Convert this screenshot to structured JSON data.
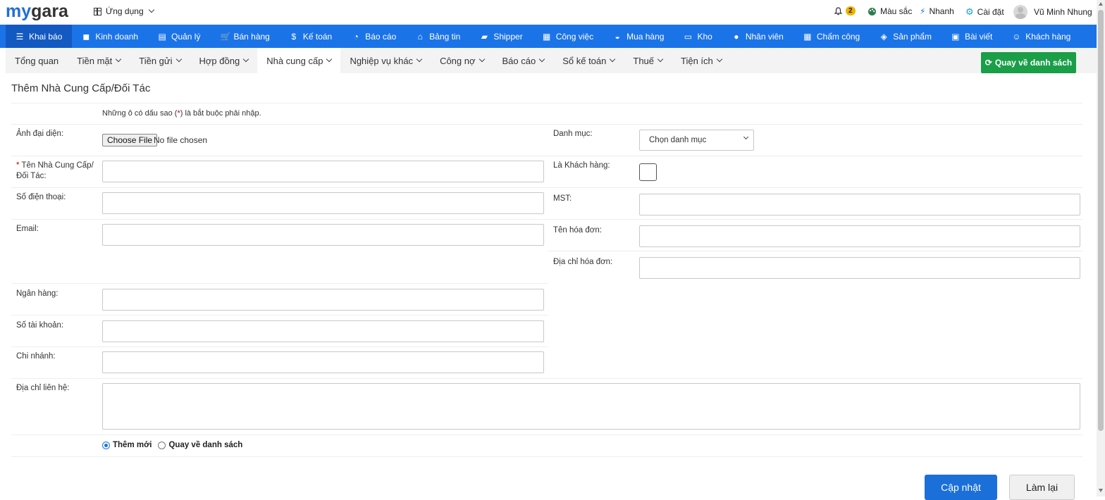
{
  "brand": {
    "logo_part1": "my",
    "logo_part2": "gara"
  },
  "topbar": {
    "apps_label": "Ứng dụng",
    "notif_count": "2",
    "color_label": "Màu sắc",
    "quick_label": "Nhanh",
    "settings_label": "Cài đặt",
    "user_name": "Vũ Minh Nhung"
  },
  "main_nav": [
    {
      "label": "Khai báo",
      "icon": "list-icon",
      "glyph": "☰"
    },
    {
      "label": "Kinh doanh",
      "icon": "bag-icon",
      "glyph": "◼"
    },
    {
      "label": "Quản lý",
      "icon": "id-card-icon",
      "glyph": "▤"
    },
    {
      "label": "Bán hàng",
      "icon": "cart-icon",
      "glyph": "🛒"
    },
    {
      "label": "Kế toán",
      "icon": "dollar-icon",
      "glyph": "$"
    },
    {
      "label": "Báo cáo",
      "icon": "pie-chart-icon",
      "glyph": "◔"
    },
    {
      "label": "Bảng tin",
      "icon": "home-icon",
      "glyph": "⌂"
    },
    {
      "label": "Shipper",
      "icon": "truck-icon",
      "glyph": "▰"
    },
    {
      "label": "Công việc",
      "icon": "calendar-icon",
      "glyph": "▦"
    },
    {
      "label": "Mua hàng",
      "icon": "basket-icon",
      "glyph": "◒"
    },
    {
      "label": "Kho",
      "icon": "warehouse-icon",
      "glyph": "▭"
    },
    {
      "label": "Nhân viên",
      "icon": "user-icon",
      "glyph": "●"
    },
    {
      "label": "Chấm công",
      "icon": "calendar-check-icon",
      "glyph": "▦"
    },
    {
      "label": "Sản phẩm",
      "icon": "box-icon",
      "glyph": "◈"
    },
    {
      "label": "Bài viết",
      "icon": "newspaper-icon",
      "glyph": "▣"
    },
    {
      "label": "Khách hàng",
      "icon": "smile-icon",
      "glyph": "☺"
    }
  ],
  "sub_nav": [
    {
      "label": "Tổng quan",
      "dropdown": false
    },
    {
      "label": "Tiền mặt",
      "dropdown": true
    },
    {
      "label": "Tiền gửi",
      "dropdown": true
    },
    {
      "label": "Hợp đồng",
      "dropdown": true
    },
    {
      "label": "Nhà cung cấp",
      "dropdown": true
    },
    {
      "label": "Nghiệp vụ khác",
      "dropdown": true
    },
    {
      "label": "Công nợ",
      "dropdown": true
    },
    {
      "label": "Báo cáo",
      "dropdown": true
    },
    {
      "label": "Sổ kế toán",
      "dropdown": true
    },
    {
      "label": "Thuế",
      "dropdown": true
    },
    {
      "label": "Tiện ích",
      "dropdown": true
    }
  ],
  "back_button": "Quay về danh sách",
  "form": {
    "title": "Thêm Nhà Cung Cấp/Đối Tác",
    "required_note_pre": "Những ô có dấu sao (",
    "required_star": "*",
    "required_note_post": ") là bắt buộc phải nhập.",
    "avatar_label": "Ảnh đại diện:",
    "file_button": "Choose File",
    "file_status": "No file chosen",
    "category_label": "Danh mục:",
    "category_value": "Chọn danh mục",
    "name_required": "*",
    "name_label": "Tên Nhà Cung Cấp/ Đối Tác:",
    "is_customer_label": "Là Khách hàng:",
    "phone_label": "Số điện thoại:",
    "tax_label": "MST:",
    "email_label": "Email:",
    "invoice_name_label": "Tên hóa đơn:",
    "invoice_address_label": "Địa chỉ hóa đơn:",
    "bank_label": "Ngân hàng:",
    "account_label": "Số tài khoản:",
    "branch_label": "Chi nhánh:",
    "contact_address_label": "Địa chỉ liên hệ:",
    "radio_new": "Thêm mới",
    "radio_back": "Quay về danh sách",
    "update_button": "Cập nhật",
    "reset_button": "Làm lại"
  }
}
